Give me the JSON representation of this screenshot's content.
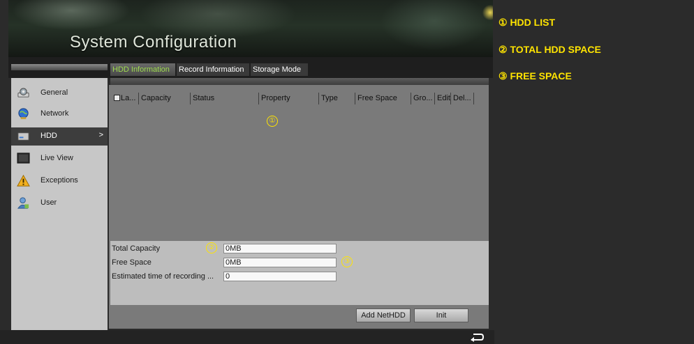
{
  "header": {
    "title": "System Configuration"
  },
  "tabs": [
    {
      "label": "HDD Information",
      "active": true
    },
    {
      "label": "Record Information",
      "active": false
    },
    {
      "label": "Storage Mode",
      "active": false
    }
  ],
  "sidebar": {
    "items": [
      {
        "label": "General",
        "icon": "general-icon",
        "active": false
      },
      {
        "label": "Network",
        "icon": "network-icon",
        "active": false
      },
      {
        "label": "HDD",
        "icon": "hdd-icon",
        "active": true,
        "arrow": ">"
      },
      {
        "label": "Live View",
        "icon": "live-view-icon",
        "active": false
      },
      {
        "label": "Exceptions",
        "icon": "warning-icon",
        "active": false
      },
      {
        "label": "User",
        "icon": "user-icon",
        "active": false
      }
    ]
  },
  "hdd_table": {
    "columns": [
      "La...",
      "Capacity",
      "Status",
      "Property",
      "Type",
      "Free Space",
      "Gro...",
      "Edit",
      "Del..."
    ],
    "rows": []
  },
  "summary": {
    "total_capacity_label": "Total Capacity",
    "total_capacity_value": "0MB",
    "free_space_label": "Free Space",
    "free_space_value": "0MB",
    "est_time_label": "Estimated time of recording ...",
    "est_time_value": "0"
  },
  "buttons": {
    "add_nethdd": "Add NetHDD",
    "init": "Init"
  },
  "markers": {
    "m1": "①",
    "m2": "②",
    "m3": "③"
  },
  "legend": {
    "items": [
      "① HDD LIST",
      "② TOTAL HDD SPACE",
      "③ FREE SPACE"
    ]
  },
  "colors": {
    "accent_yellow": "#ffe400",
    "active_tab_green": "#9edc4e"
  }
}
